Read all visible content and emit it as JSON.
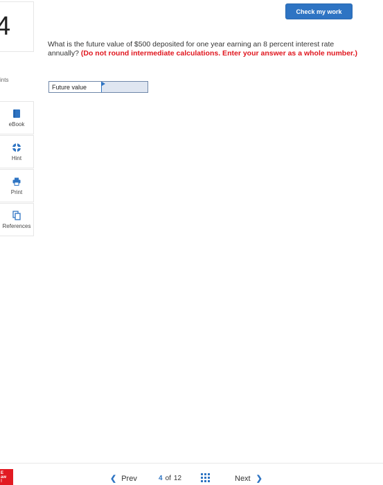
{
  "header": {
    "check_button_label": "Check my work"
  },
  "question": {
    "number": "4",
    "points_label": "ints",
    "text": "What is the future value of $500 deposited for one year earning an 8 percent interest rate annually? ",
    "instruction": "(Do not round intermediate calculations. Enter your answer as a whole number.)"
  },
  "answer": {
    "label": "Future value",
    "value": ""
  },
  "tools": [
    {
      "label": "eBook",
      "icon": "book-icon"
    },
    {
      "label": "Hint",
      "icon": "lifebuoy-icon"
    },
    {
      "label": "Print",
      "icon": "printer-icon"
    },
    {
      "label": "References",
      "icon": "documents-icon"
    }
  ],
  "footer": {
    "brand_text": "E\naw\n!",
    "prev_label": "Prev",
    "current_page": "4",
    "of_label": "of",
    "total_pages": "12",
    "next_label": "Next"
  },
  "colors": {
    "accent": "#2e74c3",
    "instruction_red": "#e0161e",
    "input_bg": "#dfe6f1",
    "brand_red": "#e21a22"
  }
}
